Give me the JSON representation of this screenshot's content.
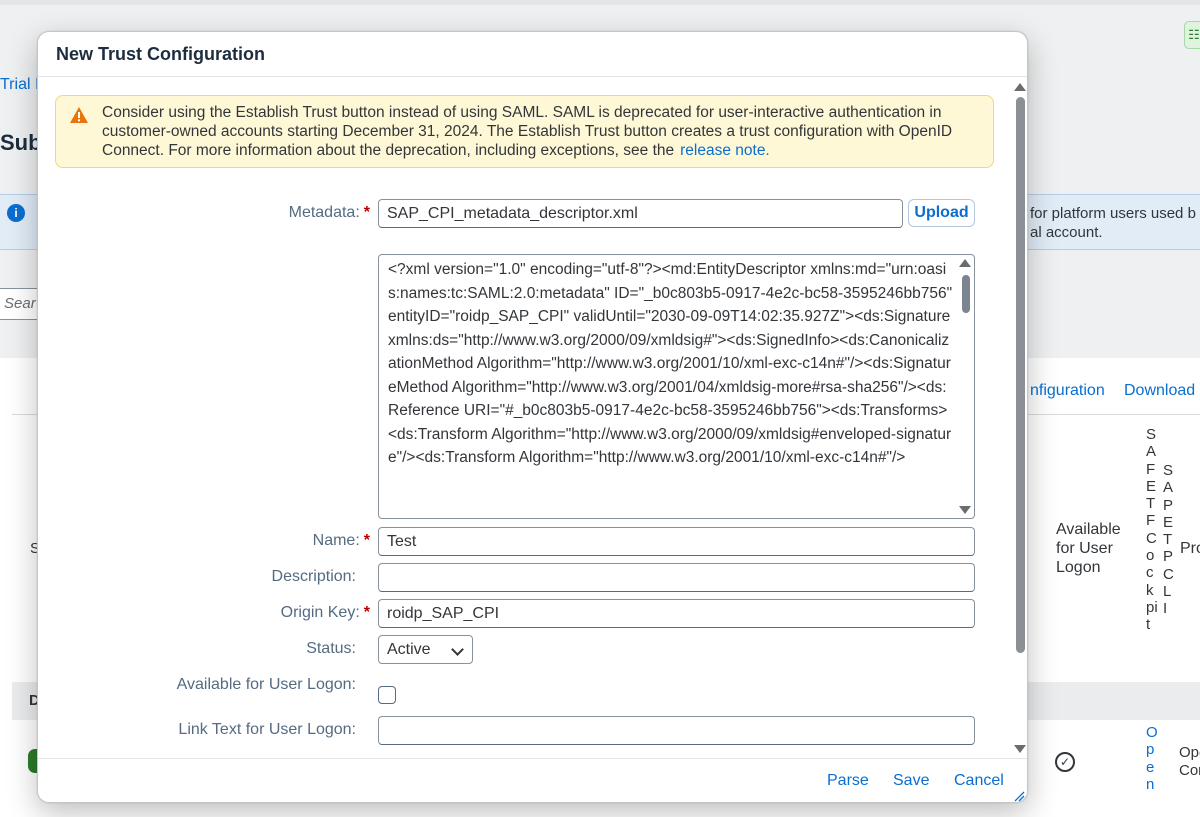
{
  "background": {
    "breadcrumb": "Trial I",
    "section_heading": "Sub",
    "info_text": "for platform users used b\nal account.",
    "search_placeholder": "Sear",
    "toolbar_links": [
      "nfiguration",
      "Download S"
    ],
    "columns": {
      "available_for_user_logon": "Available\nfor User\nLogon",
      "vertical_header_1": "SAFETFCockpit",
      "vertical_header_2": "SAPETPCLI",
      "provider": "Pro",
      "left_s": "S"
    },
    "group_row_label": "D",
    "row": {
      "open_link": "Open",
      "origin_text": "Ope\nCor"
    }
  },
  "dialog": {
    "title": "New Trust Configuration",
    "warning": {
      "text": "Consider using the Establish Trust button instead of using SAML. SAML is deprecated for user-interactive authentication in customer-owned accounts starting December 31, 2024. The Establish Trust button creates a trust configuration with OpenID Connect. For more information about the deprecation, including exceptions, see the",
      "link": "release note."
    },
    "fields": {
      "metadata_label": "Metadata:",
      "metadata_value": "SAP_CPI_metadata_descriptor.xml",
      "upload_label": "Upload",
      "metadata_xml": "<?xml version=\"1.0\" encoding=\"utf-8\"?><md:EntityDescriptor xmlns:md=\"urn:oasis:names:tc:SAML:2.0:metadata\" ID=\"_b0c803b5-0917-4e2c-bc58-3595246bb756\" entityID=\"roidp_SAP_CPI\" validUntil=\"2030-09-09T14:02:35.927Z\"><ds:Signature xmlns:ds=\"http://www.w3.org/2000/09/xmldsig#\"><ds:SignedInfo><ds:CanonicalizationMethod Algorithm=\"http://www.w3.org/2001/10/xml-exc-c14n#\"/><ds:SignatureMethod Algorithm=\"http://www.w3.org/2001/04/xmldsig-more#rsa-sha256\"/><ds:Reference URI=\"#_b0c803b5-0917-4e2c-bc58-3595246bb756\"><ds:Transforms><ds:Transform Algorithm=\"http://www.w3.org/2000/09/xmldsig#enveloped-signature\"/><ds:Transform Algorithm=\"http://www.w3.org/2001/10/xml-exc-c14n#\"/>",
      "name_label": "Name:",
      "name_value": "Test",
      "description_label": "Description:",
      "description_value": "",
      "origin_key_label": "Origin Key:",
      "origin_key_value": "roidp_SAP_CPI",
      "status_label": "Status:",
      "status_value": "Active",
      "available_label": "Available for User Logon:",
      "link_text_label": "Link Text for User Logon:",
      "link_text_value": "",
      "required_marker": "*"
    },
    "footer": {
      "parse": "Parse",
      "save": "Save",
      "cancel": "Cancel"
    }
  },
  "colors": {
    "accent": "#0a6ed1",
    "warning_bg": "#fff8d6",
    "warning_border": "#f5d67a",
    "warning_icon": "#e9730c",
    "required": "#bb0000"
  }
}
